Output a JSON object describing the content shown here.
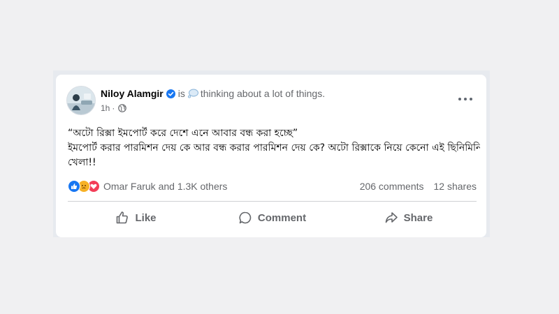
{
  "post": {
    "author": "Niloy Alamgir",
    "is_text": "is",
    "feeling": "thinking about a lot of things.",
    "time": "1h",
    "body_lines": [
      "“অটো রিক্সা ইমপোর্ট করে দেশে এনে আবার বন্ধ করা হচ্ছে”",
      "ইমপোর্ট করার পারমিশন দেয় কে আর বন্ধ করার পারমিশন দেয় কে? অটো রিক্সাকে নিয়ে কেনো এই ছিনিমিনি",
      "খেলা!!"
    ]
  },
  "reactions": {
    "icons": [
      "like-icon",
      "sad-icon",
      "love-icon"
    ],
    "summary": "Omar Faruk and 1.3K others",
    "comments": "206 comments",
    "shares": "12 shares"
  },
  "actions": {
    "like": "Like",
    "comment": "Comment",
    "share": "Share"
  },
  "colors": {
    "like_blue": "#1877f2",
    "love_red": "#f33e58",
    "sad_yellow": "#f7b125",
    "text_secondary": "#65676b"
  }
}
